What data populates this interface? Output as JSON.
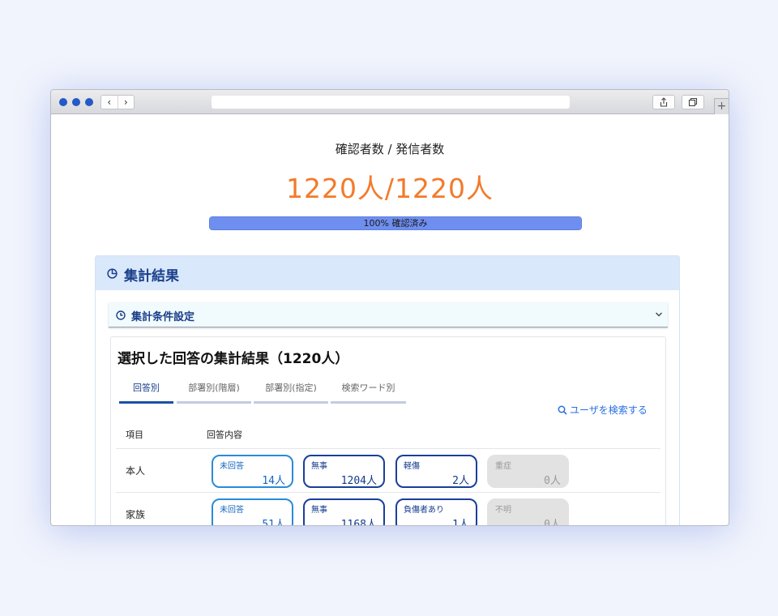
{
  "summary": {
    "label": "確認者数 / 発信者数",
    "value": "1220人/1220人",
    "progress_fraction": 1.0,
    "progress_text": "100% 確認済み"
  },
  "panel": {
    "title": "集計結果",
    "condition_title": "集計条件設定"
  },
  "results": {
    "title": "選択した回答の集計結果（1220人）",
    "tabs": [
      {
        "label": "回答別"
      },
      {
        "label": "部署別(階層)"
      },
      {
        "label": "部署別(指定)"
      },
      {
        "label": "検索ワード別"
      }
    ],
    "search_link": "ユーザを検索する",
    "columns": {
      "item": "項目",
      "answer": "回答内容"
    },
    "rows": [
      {
        "label": "本人",
        "chips": [
          {
            "name": "未回答",
            "value": "14人"
          },
          {
            "name": "無事",
            "value": "1204人"
          },
          {
            "name": "軽傷",
            "value": "2人"
          },
          {
            "name": "重症",
            "value": "0人"
          }
        ]
      },
      {
        "label": "家族",
        "chips": [
          {
            "name": "未回答",
            "value": "51人"
          },
          {
            "name": "無事",
            "value": "1168人"
          },
          {
            "name": "負傷者あり",
            "value": "1人"
          },
          {
            "name": "不明",
            "value": "0人"
          }
        ]
      }
    ]
  },
  "colors": {
    "accent_orange": "#f37a2a",
    "brand_blue": "#1a3f8a",
    "progress_blue": "#6f8ff0"
  }
}
